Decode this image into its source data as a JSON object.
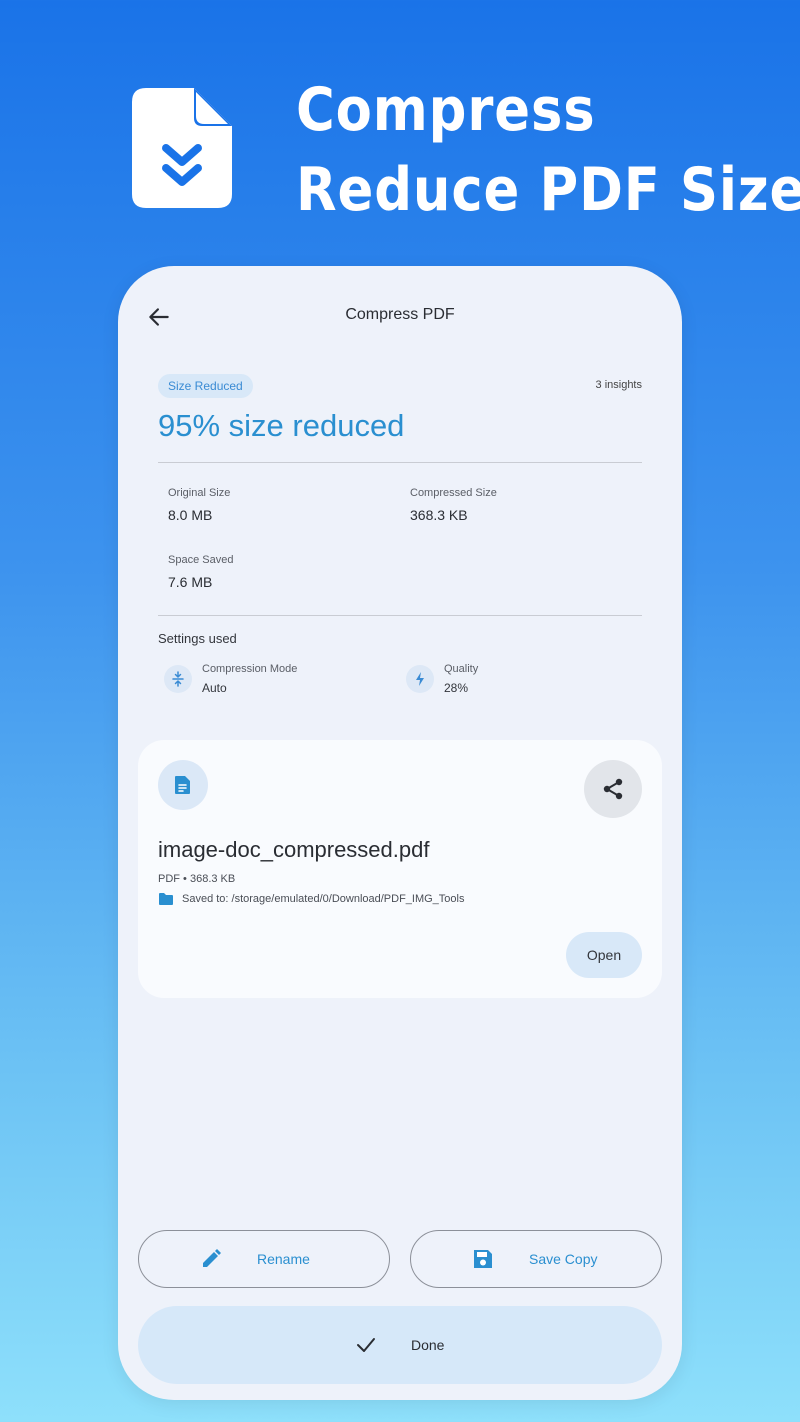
{
  "hero": {
    "title_line1": "Compress",
    "title_line2": "Reduce PDF Size",
    "icon": "compress-document-icon"
  },
  "topbar": {
    "title": "Compress PDF",
    "back_icon": "arrow-left-icon"
  },
  "summary": {
    "badge": "Size Reduced",
    "insights": "3 insights",
    "headline": "95% size reduced",
    "stats": {
      "original_label": "Original Size",
      "original_value": "8.0 MB",
      "compressed_label": "Compressed Size",
      "compressed_value": "368.3 KB",
      "saved_label": "Space Saved",
      "saved_value": "7.6 MB"
    }
  },
  "settings": {
    "title": "Settings used",
    "mode_label": "Compression Mode",
    "mode_value": "Auto",
    "quality_label": "Quality",
    "quality_value": "28%"
  },
  "file": {
    "name": "image-doc_compressed.pdf",
    "meta": "PDF • 368.3 KB",
    "path": "Saved to: /storage/emulated/0/Download/PDF_IMG_Tools",
    "open_label": "Open"
  },
  "actions": {
    "rename_label": "Rename",
    "save_copy_label": "Save Copy",
    "done_label": "Done"
  },
  "colors": {
    "accent": "#2a8fd0",
    "background_top": "#1a73e8",
    "background_bottom": "#8ee0fb",
    "card": "#eef2fa"
  }
}
